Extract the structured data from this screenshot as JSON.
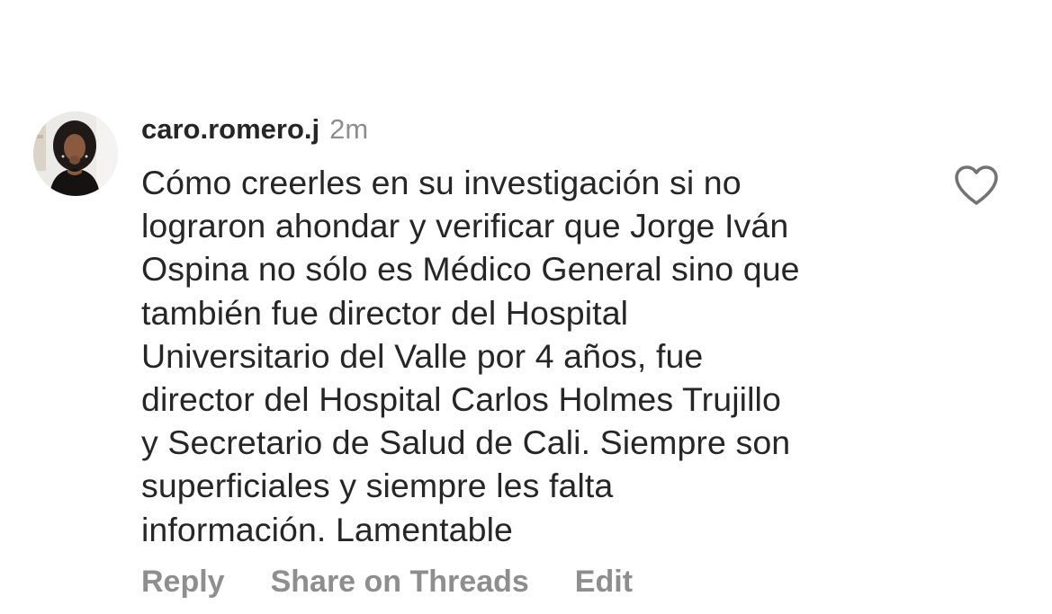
{
  "comment": {
    "username": "caro.romero.j",
    "time": "2m",
    "text_lines": [
      "Cómo creerles en su investigación si no",
      "lograron ahondar y verificar que Jorge Iván",
      "Ospina no sólo es Médico General sino que",
      "también fue director del Hospital",
      "Universitario del Valle por 4 años, fue",
      "director del Hospital Carlos Holmes Trujillo",
      "y Secretario de Salud de Cali. Siempre son",
      "superficiales y siempre les falta",
      "información. Lamentable"
    ],
    "like_icon": "heart-outline-icon"
  },
  "actions": {
    "reply": "Reply",
    "share": "Share on Threads",
    "edit": "Edit"
  },
  "colors": {
    "text": "#262626",
    "muted": "#8e8e8e",
    "background": "#ffffff"
  }
}
